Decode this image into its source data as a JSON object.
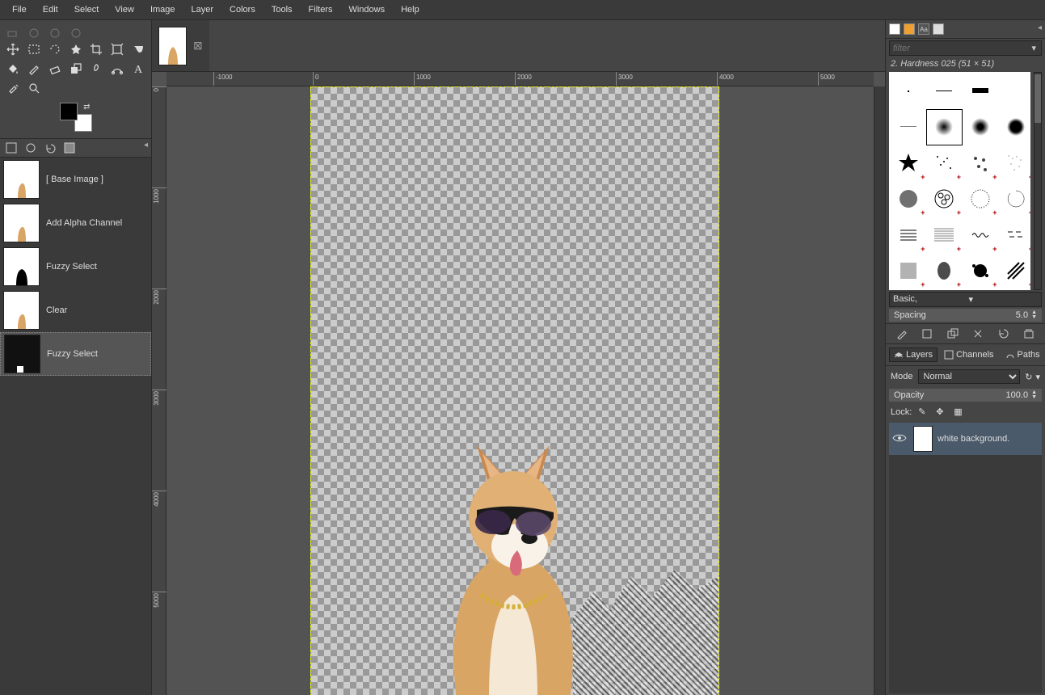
{
  "menu": [
    "File",
    "Edit",
    "Select",
    "View",
    "Image",
    "Layer",
    "Colors",
    "Tools",
    "Filters",
    "Windows",
    "Help"
  ],
  "history": [
    {
      "label": "[ Base Image ]",
      "thumb": "light"
    },
    {
      "label": "Add Alpha Channel",
      "thumb": "light"
    },
    {
      "label": "Fuzzy Select",
      "thumb": "bw"
    },
    {
      "label": "Clear",
      "thumb": "light"
    },
    {
      "label": "Fuzzy Select",
      "thumb": "dark"
    }
  ],
  "ruler_h": [
    "-1000",
    "0",
    "1000",
    "2000",
    "3000",
    "4000",
    "5000"
  ],
  "ruler_v": [
    "0",
    "1000",
    "2000",
    "3000",
    "4000",
    "5000"
  ],
  "brush_filter_placeholder": "filter",
  "brush_name": "2. Hardness 025 (51 × 51)",
  "brush_preset": "Basic,",
  "spacing_label": "Spacing",
  "spacing_value": "5.0",
  "dock_tabs": [
    "Layers",
    "Channels",
    "Paths"
  ],
  "mode_label": "Mode",
  "mode_value": "Normal",
  "opacity_label": "Opacity",
  "opacity_value": "100.0",
  "lock_label": "Lock:",
  "layer_name": "white background."
}
